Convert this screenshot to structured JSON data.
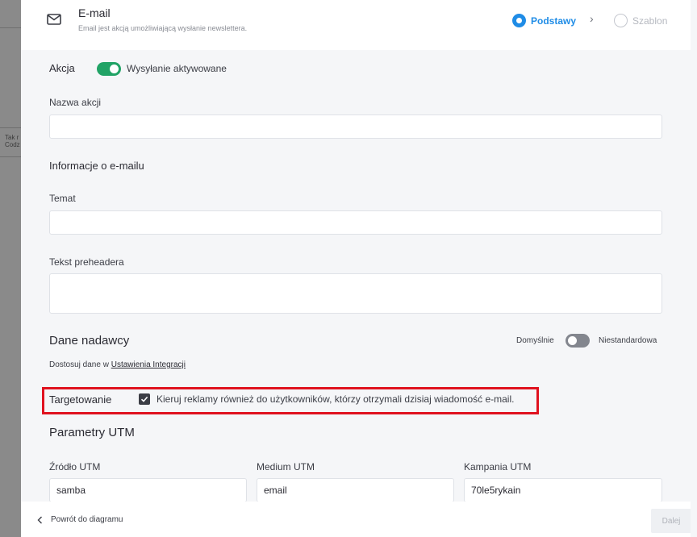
{
  "backdrop": {
    "text_1": "Tak r",
    "text_2": "Codz"
  },
  "header": {
    "title": "E-mail",
    "subtitle": "Email jest akcją umożliwiającą wysłanie newslettera.",
    "step_1": "Podstawy",
    "step_2": "Szablon"
  },
  "action": {
    "label": "Akcja",
    "toggle_label": "Wysyłanie aktywowane",
    "name_label": "Nazwa akcji",
    "name_value": ""
  },
  "email_info": {
    "heading": "Informacje o e-mailu",
    "subject_label": "Temat",
    "subject_value": "",
    "preheader_label": "Tekst preheadera",
    "preheader_value": ""
  },
  "sender": {
    "heading": "Dane nadawcy",
    "default_label": "Domyślnie",
    "custom_label": "Niestandardowa",
    "customize_prefix": "Dostosuj dane w ",
    "customize_link": "Ustawienia Integracji"
  },
  "targeting": {
    "label": "Targetowanie",
    "checkbox_label": "Kieruj reklamy również do użytkowników, którzy otrzymali dzisiaj wiadomość e-mail.",
    "checked": true
  },
  "utm": {
    "heading": "Parametry UTM",
    "source_label": "Źródło UTM",
    "source_value": "samba",
    "medium_label": "Medium UTM",
    "medium_value": "email",
    "campaign_label": "Kampania UTM",
    "campaign_value": "70le5rykain"
  },
  "footer": {
    "back_label": "Powrót do diagramu",
    "next_label": "Dalej"
  },
  "colors": {
    "accent": "#1f8ce6",
    "toggle_on": "#21a366",
    "highlight": "#e0121f"
  }
}
